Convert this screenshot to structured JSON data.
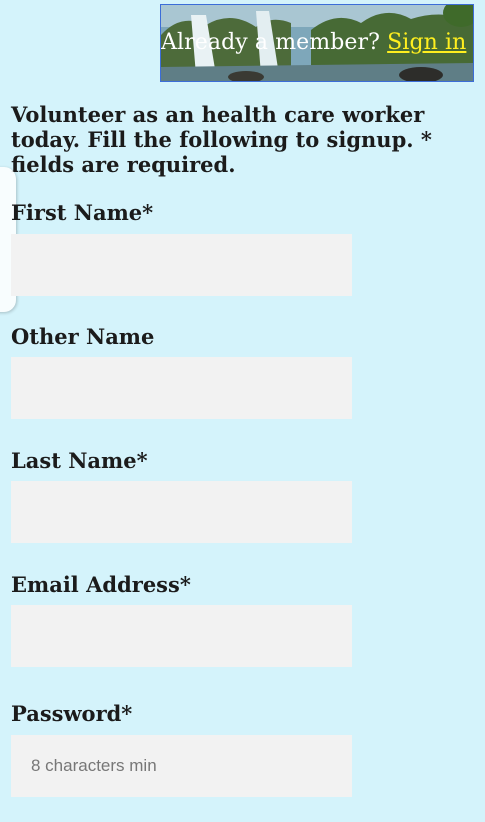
{
  "banner": {
    "prompt": "Already a member?",
    "link": "Sign in"
  },
  "intro": {
    "text": "Volunteer as an health care worker today. Fill the following to signup. * fields are required."
  },
  "form": {
    "first_name": {
      "label": "First Name*",
      "value": "",
      "placeholder": ""
    },
    "other_name": {
      "label": "Other Name",
      "value": "",
      "placeholder": ""
    },
    "last_name": {
      "label": "Last Name*",
      "value": "",
      "placeholder": ""
    },
    "email": {
      "label": "Email Address*",
      "value": "",
      "placeholder": ""
    },
    "password": {
      "label": "Password*",
      "value": "",
      "placeholder": "8 characters min"
    }
  },
  "colors": {
    "page_background": "#d4f3fb",
    "input_background": "#f2f2f2",
    "link_color": "#ffef1f"
  }
}
